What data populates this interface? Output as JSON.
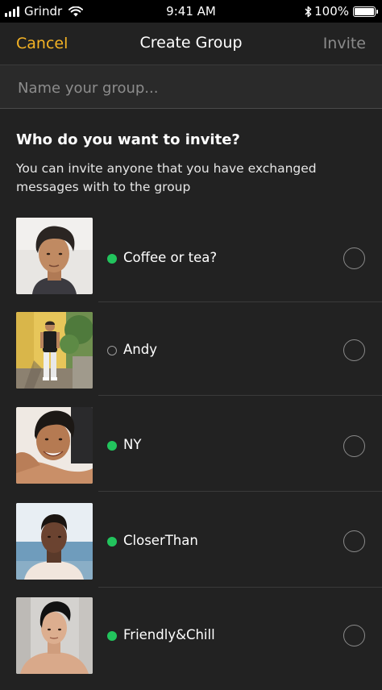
{
  "status_bar": {
    "carrier": "Grindr",
    "time": "9:41 AM",
    "battery": "100%"
  },
  "nav": {
    "cancel_label": "Cancel",
    "title": "Create Group",
    "invite_label": "Invite"
  },
  "name_input": {
    "placeholder": "Name your group...",
    "value": ""
  },
  "invite_section": {
    "title": "Who do you want to invite?",
    "description": "You can invite anyone that you have exchanged messages with to the group"
  },
  "contacts": [
    {
      "name": "Coffee or tea?",
      "online": true,
      "selected": false
    },
    {
      "name": "Andy",
      "online": false,
      "selected": false
    },
    {
      "name": "NY",
      "online": true,
      "selected": false
    },
    {
      "name": "CloserThan",
      "online": true,
      "selected": false
    },
    {
      "name": "Friendly&Chill",
      "online": true,
      "selected": false
    }
  ],
  "colors": {
    "accent": "#f5b324",
    "online": "#22c45d",
    "background": "#222222"
  }
}
